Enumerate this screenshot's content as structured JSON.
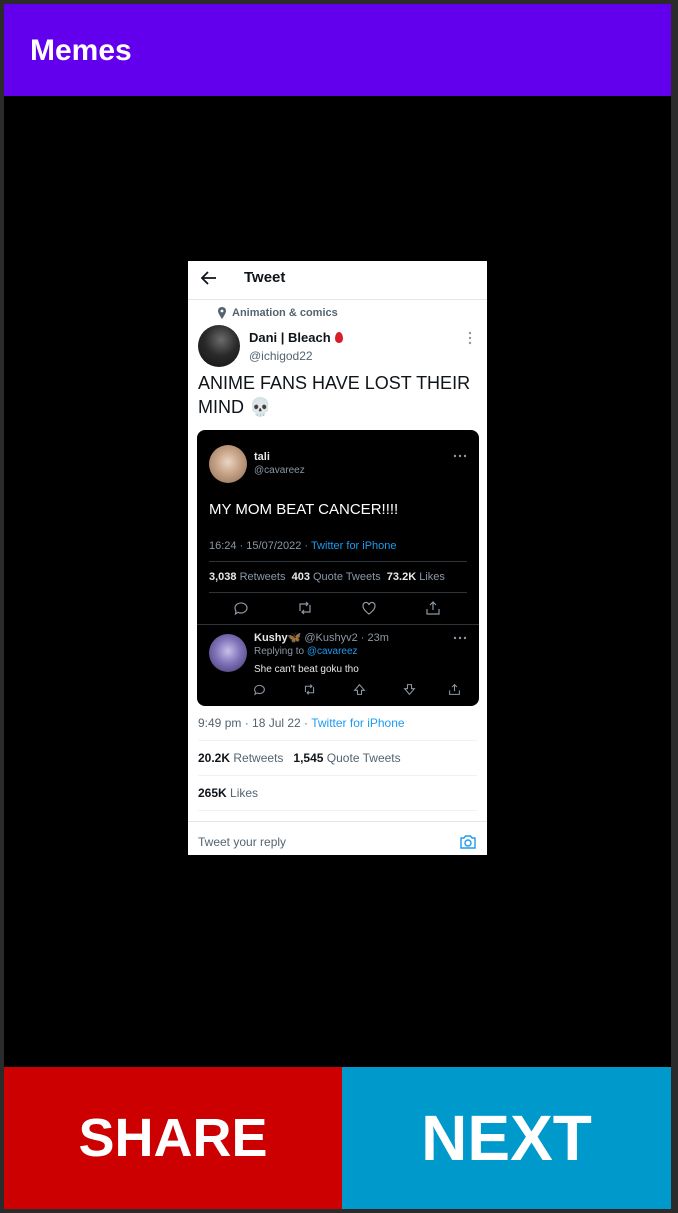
{
  "app": {
    "title": "Memes"
  },
  "meme": {
    "header_title": "Tweet",
    "topic": "Animation & comics",
    "author_name": "Dani | Bleach",
    "author_handle": "@ichigod22",
    "text": "ANIME FANS HAVE LOST THEIR MIND 💀",
    "quoted": {
      "name": "tali",
      "handle": "@cavareez",
      "text": "MY MOM BEAT CANCER!!!!",
      "time": "16:24 · 15/07/2022 · ",
      "source": "Twitter for iPhone",
      "retweets_count": "3,038",
      "retweets_label": "Retweets",
      "quotes_count": "403",
      "quotes_label": "Quote Tweets",
      "likes_count": "73.2K",
      "likes_label": "Likes",
      "reply": {
        "name": "Kushy🦋",
        "meta": "@Kushyv2 · 23m",
        "replying_label": "Replying to ",
        "replying_handle": "@cavareez",
        "text": "She can't beat goku tho"
      }
    },
    "time": "9:49 pm · 18 Jul 22 · ",
    "source": "Twitter for iPhone",
    "retweets_count": "20.2K",
    "retweets_label": "Retweets",
    "quotes_count": "1,545",
    "quotes_label": "Quote Tweets",
    "likes_count": "265K",
    "likes_label": "Likes",
    "reply_placeholder": "Tweet your reply"
  },
  "buttons": {
    "share": "SHARE",
    "next": "NEXT"
  },
  "colors": {
    "app_bar": "#6200ee",
    "share": "#cc0000",
    "next": "#0099cc",
    "link": "#1d9bf0"
  }
}
